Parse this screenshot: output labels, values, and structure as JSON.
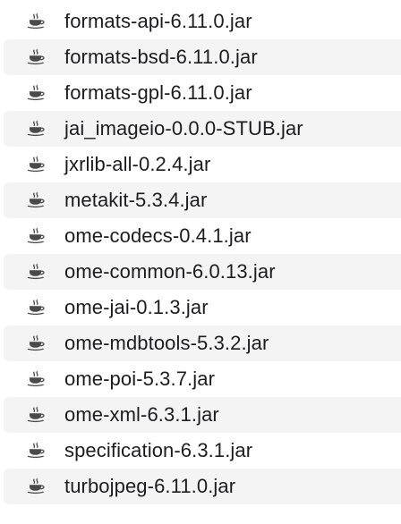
{
  "window": {
    "view": "list"
  },
  "colors": {
    "text": "#1d1d1f",
    "alt_row": "#f4f4f5",
    "icon": "#4a4a4a"
  },
  "files": [
    {
      "name": "formats-api-6.11.0.jar",
      "icon": "java-jar-icon"
    },
    {
      "name": "formats-bsd-6.11.0.jar",
      "icon": "java-jar-icon"
    },
    {
      "name": "formats-gpl-6.11.0.jar",
      "icon": "java-jar-icon"
    },
    {
      "name": "jai_imageio-0.0.0-STUB.jar",
      "icon": "java-jar-icon"
    },
    {
      "name": "jxrlib-all-0.2.4.jar",
      "icon": "java-jar-icon"
    },
    {
      "name": "metakit-5.3.4.jar",
      "icon": "java-jar-icon"
    },
    {
      "name": "ome-codecs-0.4.1.jar",
      "icon": "java-jar-icon"
    },
    {
      "name": "ome-common-6.0.13.jar",
      "icon": "java-jar-icon"
    },
    {
      "name": "ome-jai-0.1.3.jar",
      "icon": "java-jar-icon"
    },
    {
      "name": "ome-mdbtools-5.3.2.jar",
      "icon": "java-jar-icon"
    },
    {
      "name": "ome-poi-5.3.7.jar",
      "icon": "java-jar-icon"
    },
    {
      "name": "ome-xml-6.3.1.jar",
      "icon": "java-jar-icon"
    },
    {
      "name": "specification-6.3.1.jar",
      "icon": "java-jar-icon"
    },
    {
      "name": "turbojpeg-6.11.0.jar",
      "icon": "java-jar-icon"
    }
  ]
}
